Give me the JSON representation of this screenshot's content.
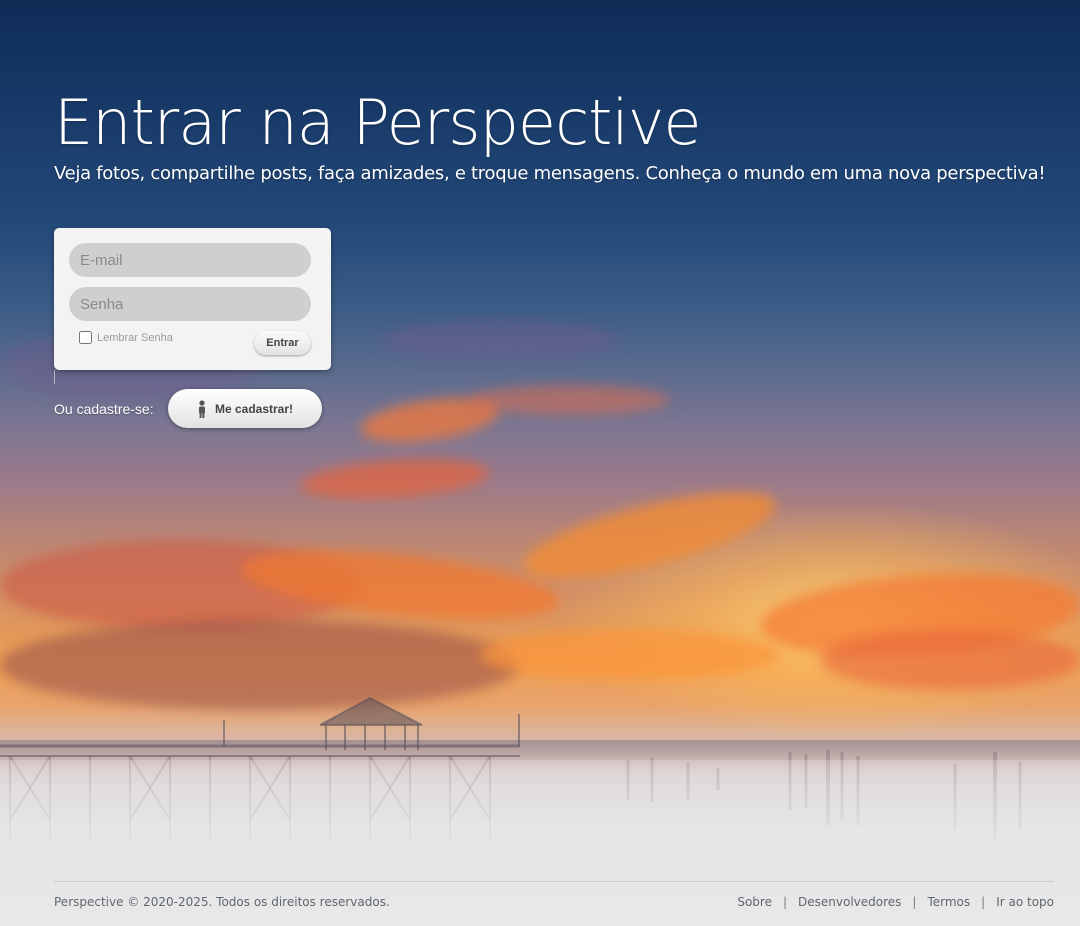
{
  "header": {
    "title": "Entrar na Perspective",
    "subtitle": "Veja fotos, compartilhe posts, faça amizades, e troque mensagens. Conheça o mundo em uma nova perspectiva!"
  },
  "login": {
    "email_placeholder": "E-mail",
    "email_value": "",
    "password_placeholder": "Senha",
    "password_value": "",
    "remember_label": "Lembrar Senha",
    "remember_checked": false,
    "submit_label": "Entrar"
  },
  "signup": {
    "prompt": "Ou cadastre-se:",
    "button_label": "Me cadastrar!",
    "button_icon": "person-icon"
  },
  "footer": {
    "copyright": "Perspective © 2020-2025. Todos os direitos reservados.",
    "links": [
      {
        "label": "Sobre"
      },
      {
        "label": "Desenvolvedores"
      },
      {
        "label": "Termos"
      },
      {
        "label": "Ir ao topo"
      }
    ],
    "separator": "|"
  },
  "colors": {
    "card_bg": "#f3f3f3",
    "input_bg": "#cfcfcf",
    "footer_text": "#5f6770",
    "heading_text": "#ffffff"
  }
}
